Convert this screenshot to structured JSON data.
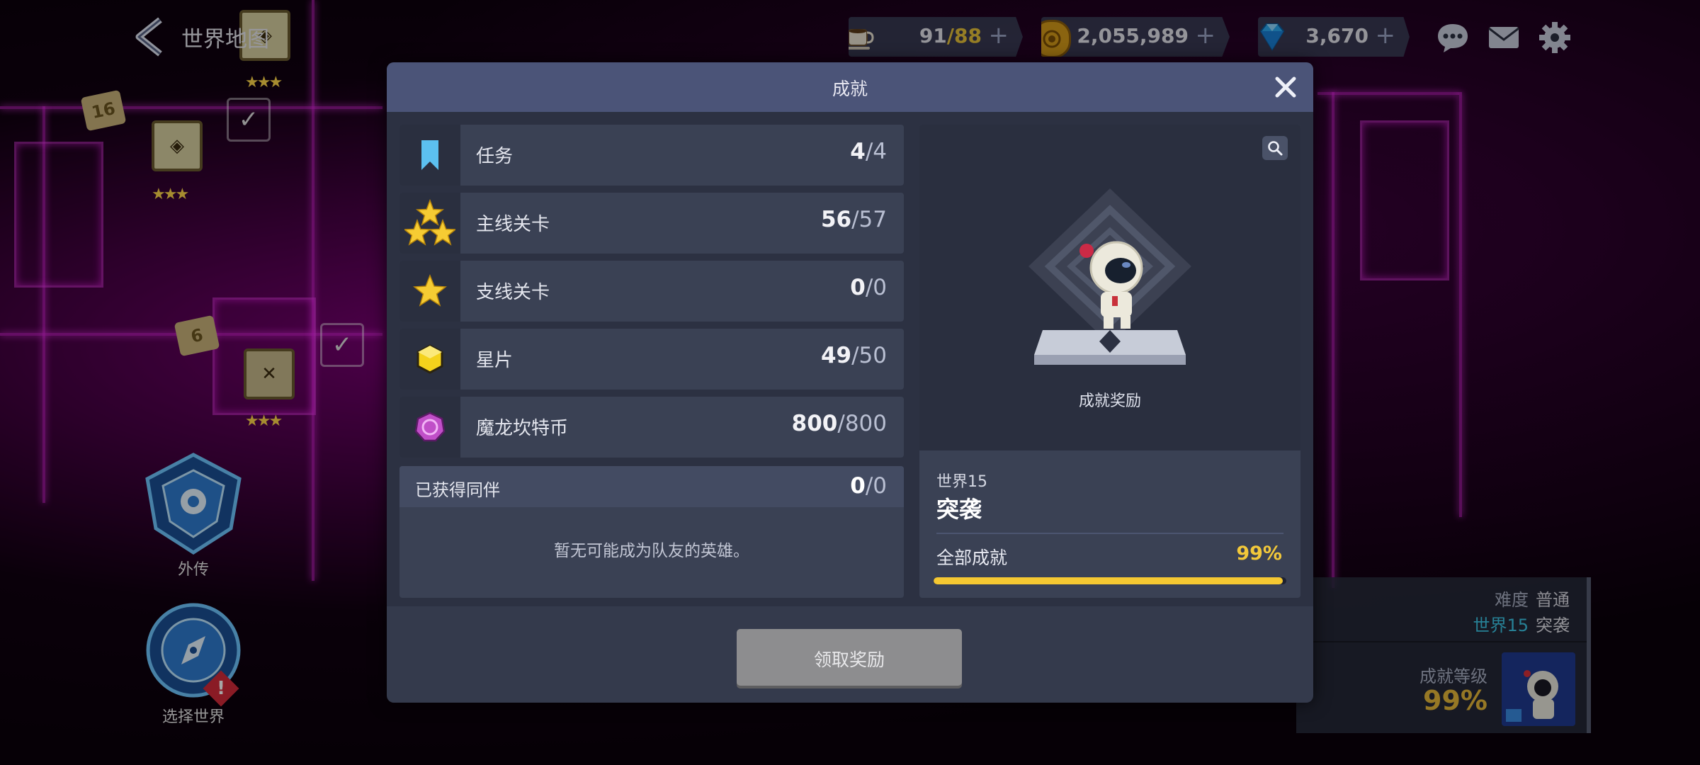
{
  "header": {
    "map_title": "世界地图"
  },
  "resources": {
    "stamina": {
      "icon": "coffee-cup-icon",
      "current": "91",
      "max": "/88"
    },
    "gold": {
      "icon": "gold-coin-icon",
      "value": "2,055,989"
    },
    "gems": {
      "icon": "blue-gem-icon",
      "value": "3,670"
    },
    "plus": "+"
  },
  "top_icons": [
    "chat-bubble-icon",
    "mail-icon",
    "gear-icon"
  ],
  "map": {
    "tiles": [
      "16",
      "6"
    ],
    "stars": "★★★"
  },
  "side_buttons": [
    {
      "label": "外传",
      "icon": "side-story-emblem-icon"
    },
    {
      "label": "选择世界",
      "icon": "compass-emblem-icon",
      "alert": "!"
    }
  ],
  "info_panel": {
    "difficulty_label": "难度",
    "difficulty_value": "普通",
    "world_label": "世界15",
    "world_name": "突袭",
    "level_label": "成就等级",
    "level_value": "99%"
  },
  "modal": {
    "title": "成就",
    "rows": [
      {
        "icon": "bookmark-icon",
        "label": "任务",
        "count": "4",
        "total": "/4"
      },
      {
        "icon": "three-stars-icon",
        "label": "主线关卡",
        "count": "56",
        "total": "/57"
      },
      {
        "icon": "star-icon",
        "label": "支线关卡",
        "count": "0",
        "total": "/0"
      },
      {
        "icon": "star-shard-icon",
        "label": "星片",
        "count": "49",
        "total": "/50"
      },
      {
        "icon": "dragon-coin-icon",
        "label": "魔龙坎特币",
        "count": "800",
        "total": "/800"
      }
    ],
    "companions": {
      "label": "已获得同伴",
      "count": "0",
      "total": "/0",
      "empty_text": "暂无可能成为队友的英雄。"
    },
    "reward": {
      "caption": "成就奖励",
      "world": "世界15",
      "world_name": "突袭",
      "all_label": "全部成就",
      "all_value": "99%",
      "progress": 0.99
    },
    "claim_button": "领取奖励"
  },
  "colors": {
    "accent_gold": "#f5c832",
    "modal_header": "#4b5478",
    "neon_magenta": "#e628e6"
  }
}
